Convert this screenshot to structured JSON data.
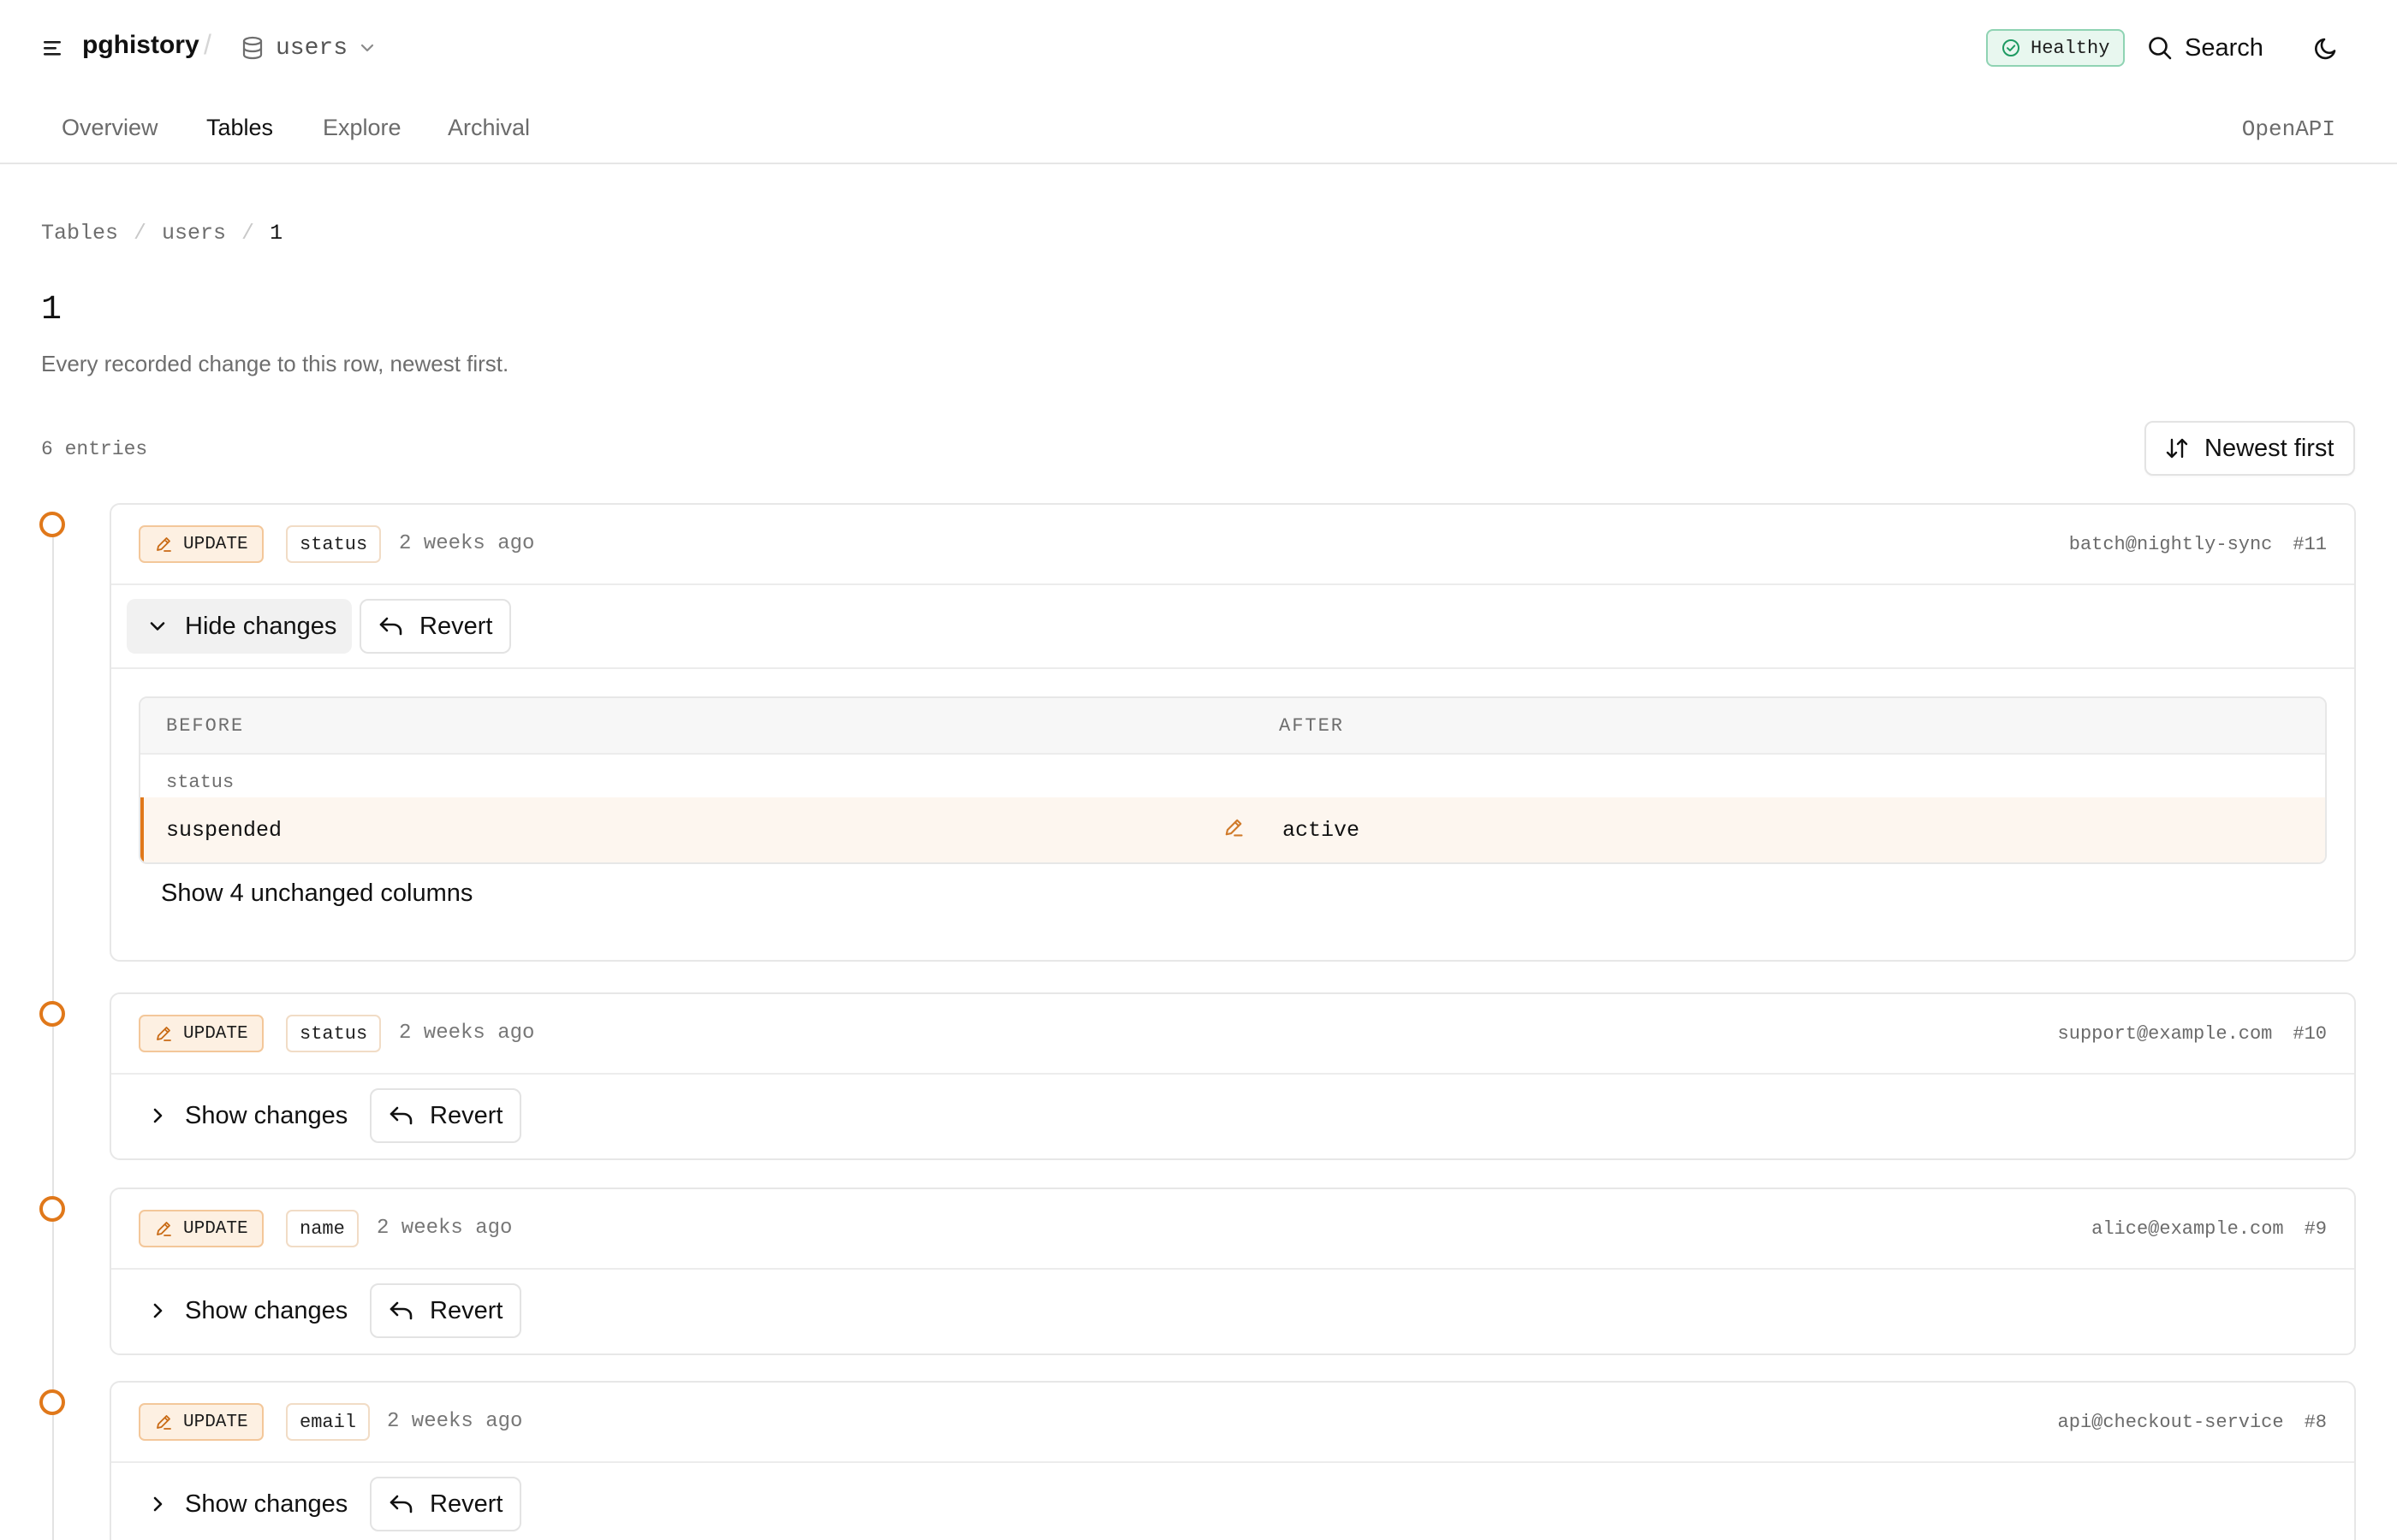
{
  "app": {
    "brand": "pghistory",
    "db_selector": "users",
    "health": "Healthy",
    "search_label": "Search"
  },
  "nav": {
    "tabs": [
      {
        "label": "Overview",
        "active": false
      },
      {
        "label": "Tables",
        "active": true
      },
      {
        "label": "Explore",
        "active": false
      },
      {
        "label": "Archival",
        "active": false
      }
    ],
    "openapi": "OpenAPI"
  },
  "breadcrumb": [
    "Tables",
    "users",
    "1"
  ],
  "page": {
    "title": "1",
    "subtitle": "Every recorded change to this row, newest first.",
    "count": "6 entries",
    "sort_label": "Newest first"
  },
  "entries": [
    {
      "op": "UPDATE",
      "column": "status",
      "when": "2 weeks ago",
      "actor": "batch@nightly-sync",
      "id": "#11",
      "toggle": "Hide changes",
      "revert": "Revert",
      "expanded": true,
      "diff": {
        "before_header": "BEFORE",
        "after_header": "AFTER",
        "column": "status",
        "before": "suspended",
        "after": "active",
        "unchanged": "Show 4 unchanged columns"
      }
    },
    {
      "op": "UPDATE",
      "column": "status",
      "when": "2 weeks ago",
      "actor": "support@example.com",
      "id": "#10",
      "toggle": "Show changes",
      "revert": "Revert",
      "expanded": false
    },
    {
      "op": "UPDATE",
      "column": "name",
      "when": "2 weeks ago",
      "actor": "alice@example.com",
      "id": "#9",
      "toggle": "Show changes",
      "revert": "Revert",
      "expanded": false
    },
    {
      "op": "UPDATE",
      "column": "email",
      "when": "2 weeks ago",
      "actor": "api@checkout-service",
      "id": "#8",
      "toggle": "Show changes",
      "revert": "Revert",
      "expanded": false
    }
  ],
  "colors": {
    "accent": "#e0781a",
    "badge_bg": "#fdf0e2",
    "health_bg": "#e8f7ef",
    "health_border": "#8fd3b3"
  },
  "icons": [
    "menu-icon",
    "database-icon",
    "chevron-down-icon",
    "check-circle-icon",
    "search-icon",
    "moon-icon",
    "sort-icon",
    "pencil-icon",
    "chevron-right-icon",
    "undo-icon"
  ]
}
